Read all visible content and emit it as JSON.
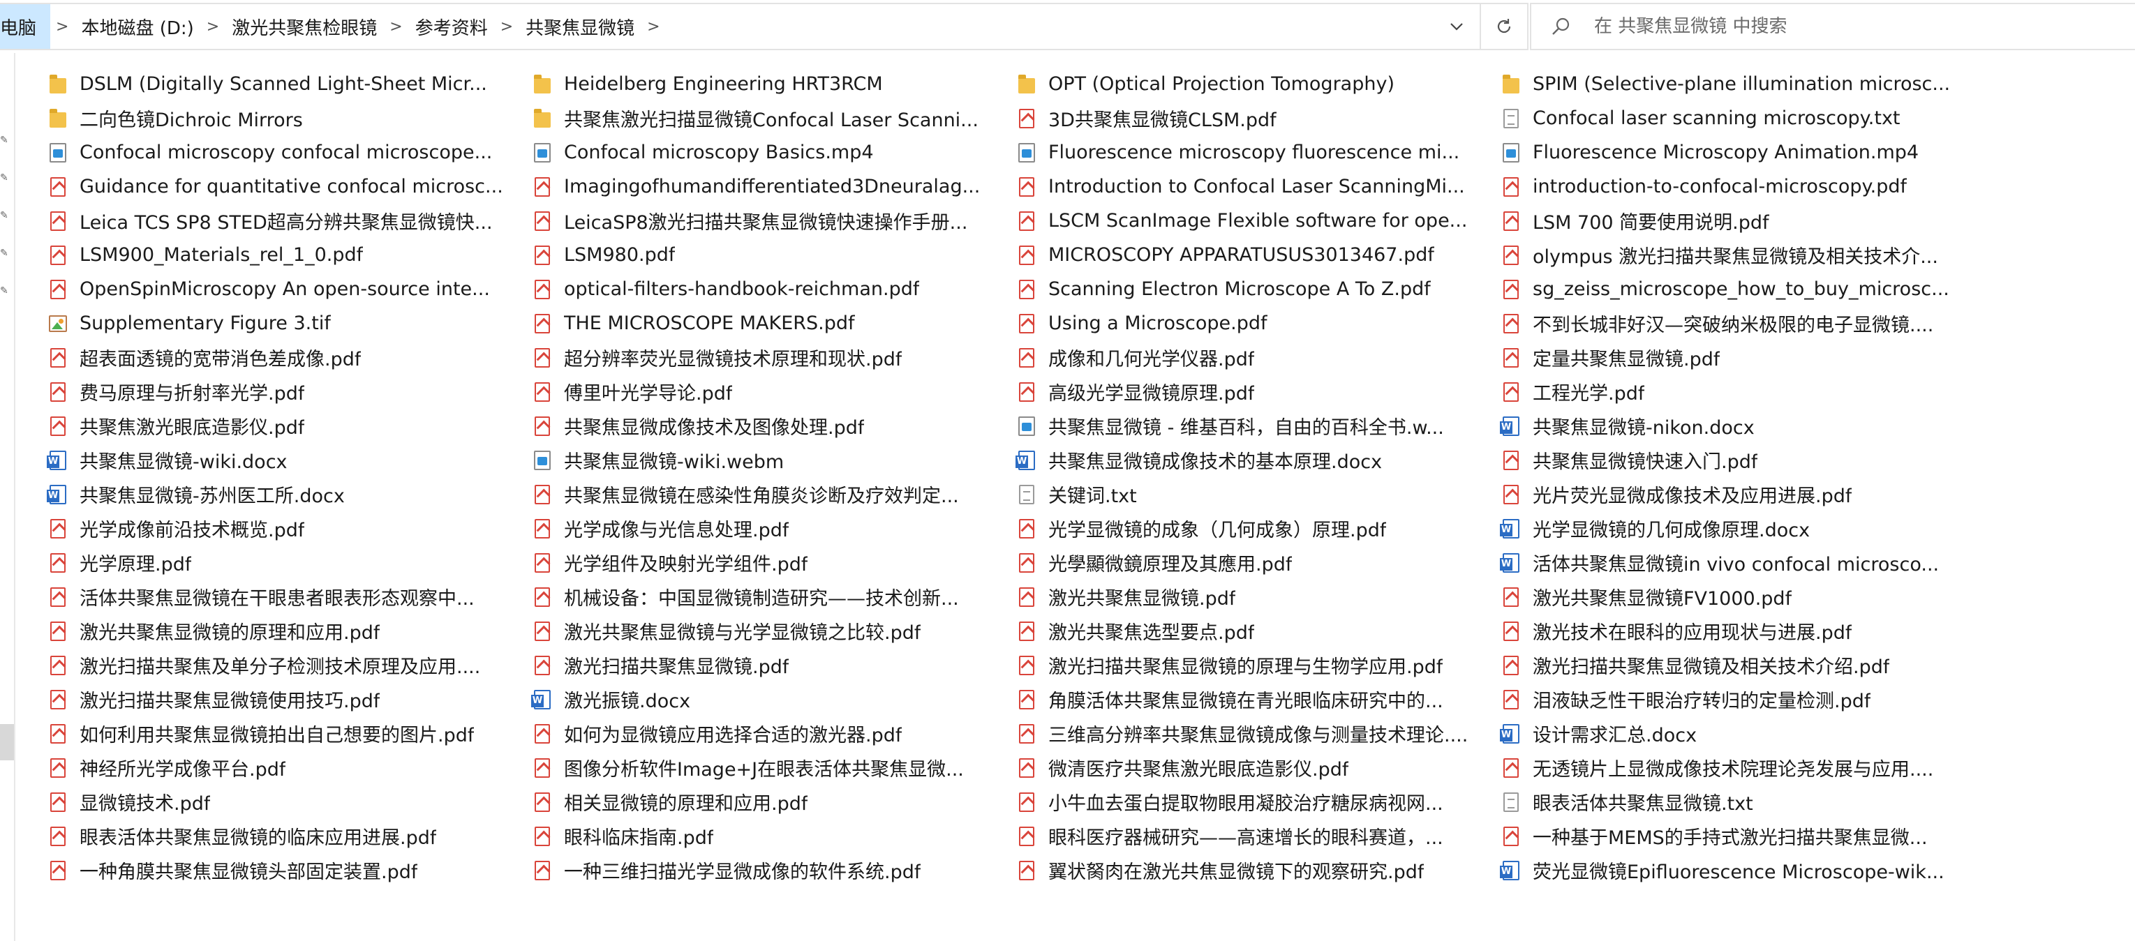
{
  "address_bar": {
    "breadcrumbs": [
      "电脑",
      "本地磁盘 (D:)",
      "激光共聚焦检眼镜",
      "参考资料",
      "共聚焦显微镜"
    ],
    "separator": ">",
    "dropdown_icon": "chevron-down-icon",
    "refresh_icon": "refresh-icon"
  },
  "search": {
    "placeholder": "在 共聚焦显微镜 中搜索"
  },
  "colors": {
    "selected_crumb": "#cce8ff",
    "pdf_icon": "#d9443a",
    "folder_icon": "#f3c24b",
    "word_icon": "#2b6cc4"
  },
  "files": {
    "columns": [
      [
        {
          "name": "DSLM (Digitally Scanned Light-Sheet Micr...",
          "type": "folder"
        },
        {
          "name": "二向色镜Dichroic Mirrors",
          "type": "folder"
        },
        {
          "name": "Confocal microscopy  confocal microscope...",
          "type": "video"
        },
        {
          "name": "Guidance for quantitative confocal microsc...",
          "type": "pdf"
        },
        {
          "name": "Leica TCS SP8 STED超高分辨共聚焦显微镜快...",
          "type": "pdf"
        },
        {
          "name": "LSM900_Materials_rel_1_0.pdf",
          "type": "pdf"
        },
        {
          "name": "OpenSpinMicroscopy An open-source inte...",
          "type": "pdf"
        },
        {
          "name": "Supplementary Figure 3.tif",
          "type": "image"
        },
        {
          "name": "超表面透镜的宽带消色差成像.pdf",
          "type": "pdf"
        },
        {
          "name": "费马原理与折射率光学.pdf",
          "type": "pdf"
        },
        {
          "name": "共聚焦激光眼底造影仪.pdf",
          "type": "pdf"
        },
        {
          "name": "共聚焦显微镜-wiki.docx",
          "type": "docx"
        },
        {
          "name": "共聚焦显微镜-苏州医工所.docx",
          "type": "docx"
        },
        {
          "name": "光学成像前沿技术概览.pdf",
          "type": "pdf"
        },
        {
          "name": "光学原理.pdf",
          "type": "pdf"
        },
        {
          "name": "活体共聚焦显微镜在干眼患者眼表形态观察中...",
          "type": "pdf"
        },
        {
          "name": "激光共聚焦显微镜的原理和应用.pdf",
          "type": "pdf"
        },
        {
          "name": "激光扫描共聚焦及单分子检测技术原理及应用....",
          "type": "pdf"
        },
        {
          "name": "激光扫描共聚焦显微镜使用技巧.pdf",
          "type": "pdf"
        },
        {
          "name": "如何利用共聚焦显微镜拍出自己想要的图片.pdf",
          "type": "pdf"
        },
        {
          "name": "神经所光学成像平台.pdf",
          "type": "pdf"
        },
        {
          "name": "显微镜技术.pdf",
          "type": "pdf"
        },
        {
          "name": "眼表活体共聚焦显微镜的临床应用进展.pdf",
          "type": "pdf"
        },
        {
          "name": "一种角膜共聚焦显微镜头部固定装置.pdf",
          "type": "pdf"
        }
      ],
      [
        {
          "name": "Heidelberg Engineering HRT3RCM",
          "type": "folder"
        },
        {
          "name": "共聚焦激光扫描显微镜Confocal Laser Scanni...",
          "type": "folder"
        },
        {
          "name": "Confocal microscopy Basics.mp4",
          "type": "video"
        },
        {
          "name": "Imagingofhumandifferentiated3Dneuralag...",
          "type": "pdf"
        },
        {
          "name": "LeicaSP8激光扫描共聚焦显微镜快速操作手册...",
          "type": "pdf"
        },
        {
          "name": "LSM980.pdf",
          "type": "pdf"
        },
        {
          "name": "optical-filters-handbook-reichman.pdf",
          "type": "pdf"
        },
        {
          "name": "THE MICROSCOPE MAKERS.pdf",
          "type": "pdf"
        },
        {
          "name": "超分辨率荧光显微镜技术原理和现状.pdf",
          "type": "pdf"
        },
        {
          "name": "傅里叶光学导论.pdf",
          "type": "pdf"
        },
        {
          "name": "共聚焦显微成像技术及图像处理.pdf",
          "type": "pdf"
        },
        {
          "name": "共聚焦显微镜-wiki.webm",
          "type": "video"
        },
        {
          "name": "共聚焦显微镜在感染性角膜炎诊断及疗效判定...",
          "type": "pdf"
        },
        {
          "name": "光学成像与光信息处理.pdf",
          "type": "pdf"
        },
        {
          "name": "光学组件及映射光学组件.pdf",
          "type": "pdf"
        },
        {
          "name": "机械设备：中国显微镜制造研究——技术创新...",
          "type": "pdf"
        },
        {
          "name": "激光共聚焦显微镜与光学显微镜之比较.pdf",
          "type": "pdf"
        },
        {
          "name": "激光扫描共聚焦显微镜.pdf",
          "type": "pdf"
        },
        {
          "name": "激光振镜.docx",
          "type": "docx"
        },
        {
          "name": "如何为显微镜应用选择合适的激光器.pdf",
          "type": "pdf"
        },
        {
          "name": "图像分析软件Image+J在眼表活体共聚焦显微...",
          "type": "pdf"
        },
        {
          "name": "相关显微镜的原理和应用.pdf",
          "type": "pdf"
        },
        {
          "name": "眼科临床指南.pdf",
          "type": "pdf"
        },
        {
          "name": "一种三维扫描光学显微成像的软件系统.pdf",
          "type": "pdf"
        }
      ],
      [
        {
          "name": "OPT (Optical Projection Tomography)",
          "type": "folder"
        },
        {
          "name": "3D共聚焦显微镜CLSM.pdf",
          "type": "pdf"
        },
        {
          "name": "Fluorescence microscopy  fluorescence mi...",
          "type": "video"
        },
        {
          "name": "Introduction to Confocal Laser ScanningMi...",
          "type": "pdf"
        },
        {
          "name": "LSCM ScanImage Flexible software for ope...",
          "type": "pdf"
        },
        {
          "name": "MICROSCOPY APPARATUSUS3013467.pdf",
          "type": "pdf"
        },
        {
          "name": "Scanning Electron Microscope A To Z.pdf",
          "type": "pdf"
        },
        {
          "name": "Using a Microscope.pdf",
          "type": "pdf"
        },
        {
          "name": "成像和几何光学仪器.pdf",
          "type": "pdf"
        },
        {
          "name": "高级光学显微镜原理.pdf",
          "type": "pdf"
        },
        {
          "name": "共聚焦显微镜 - 维基百科，自由的百科全书.w...",
          "type": "video"
        },
        {
          "name": "共聚焦显微镜成像技术的基本原理.docx",
          "type": "docx"
        },
        {
          "name": "关键词.txt",
          "type": "txt"
        },
        {
          "name": "光学显微镜的成象（几何成象）原理.pdf",
          "type": "pdf"
        },
        {
          "name": "光學顯微鏡原理及其應用.pdf",
          "type": "pdf"
        },
        {
          "name": "激光共聚焦显微镜.pdf",
          "type": "pdf"
        },
        {
          "name": "激光共聚焦选型要点.pdf",
          "type": "pdf"
        },
        {
          "name": "激光扫描共聚焦显微镜的原理与生物学应用.pdf",
          "type": "pdf"
        },
        {
          "name": "角膜活体共聚焦显微镜在青光眼临床研究中的...",
          "type": "pdf"
        },
        {
          "name": "三维高分辨率共聚焦显微镜成像与测量技术理论....",
          "type": "pdf"
        },
        {
          "name": "微清医疗共聚焦激光眼底造影仪.pdf",
          "type": "pdf"
        },
        {
          "name": "小牛血去蛋白提取物眼用凝胶治疗糖尿病视网...",
          "type": "pdf"
        },
        {
          "name": "眼科医疗器械研究——高速增长的眼科赛道，...",
          "type": "pdf"
        },
        {
          "name": "翼状胬肉在激光共焦显微镜下的观察研究.pdf",
          "type": "pdf"
        }
      ],
      [
        {
          "name": "SPIM (Selective-plane illumination microsc...",
          "type": "folder"
        },
        {
          "name": "Confocal laser scanning microscopy.txt",
          "type": "txt"
        },
        {
          "name": "Fluorescence Microscopy Animation.mp4",
          "type": "video"
        },
        {
          "name": "introduction-to-confocal-microscopy.pdf",
          "type": "pdf"
        },
        {
          "name": "LSM 700 简要使用说明.pdf",
          "type": "pdf"
        },
        {
          "name": "olympus 激光扫描共聚焦显微镜及相关技术介...",
          "type": "pdf"
        },
        {
          "name": "sg_zeiss_microscope_how_to_buy_microsc...",
          "type": "pdf"
        },
        {
          "name": "不到长城非好汉—突破纳米极限的电子显微镜....",
          "type": "pdf"
        },
        {
          "name": "定量共聚焦显微镜.pdf",
          "type": "pdf"
        },
        {
          "name": "工程光学.pdf",
          "type": "pdf"
        },
        {
          "name": "共聚焦显微镜-nikon.docx",
          "type": "docx"
        },
        {
          "name": "共聚焦显微镜快速入门.pdf",
          "type": "pdf"
        },
        {
          "name": "光片荧光显微成像技术及应用进展.pdf",
          "type": "pdf"
        },
        {
          "name": "光学显微镜的几何成像原理.docx",
          "type": "docx"
        },
        {
          "name": "活体共聚焦显微镜in vivo confocal microsco...",
          "type": "docx"
        },
        {
          "name": "激光共聚焦显微镜FV1000.pdf",
          "type": "pdf"
        },
        {
          "name": "激光技术在眼科的应用现状与进展.pdf",
          "type": "pdf"
        },
        {
          "name": "激光扫描共聚焦显微镜及相关技术介绍.pdf",
          "type": "pdf"
        },
        {
          "name": "泪液缺乏性干眼治疗转归的定量检测.pdf",
          "type": "pdf"
        },
        {
          "name": "设计需求汇总.docx",
          "type": "docx"
        },
        {
          "name": "无透镜片上显微成像技术院理论尧发展与应用....",
          "type": "pdf"
        },
        {
          "name": "眼表活体共聚焦显微镜.txt",
          "type": "txt"
        },
        {
          "name": "一种基于MEMS的手持式激光扫描共聚焦显微...",
          "type": "pdf"
        },
        {
          "name": "荧光显微镜Epifluorescence Microscope-wik...",
          "type": "docx"
        }
      ]
    ]
  }
}
